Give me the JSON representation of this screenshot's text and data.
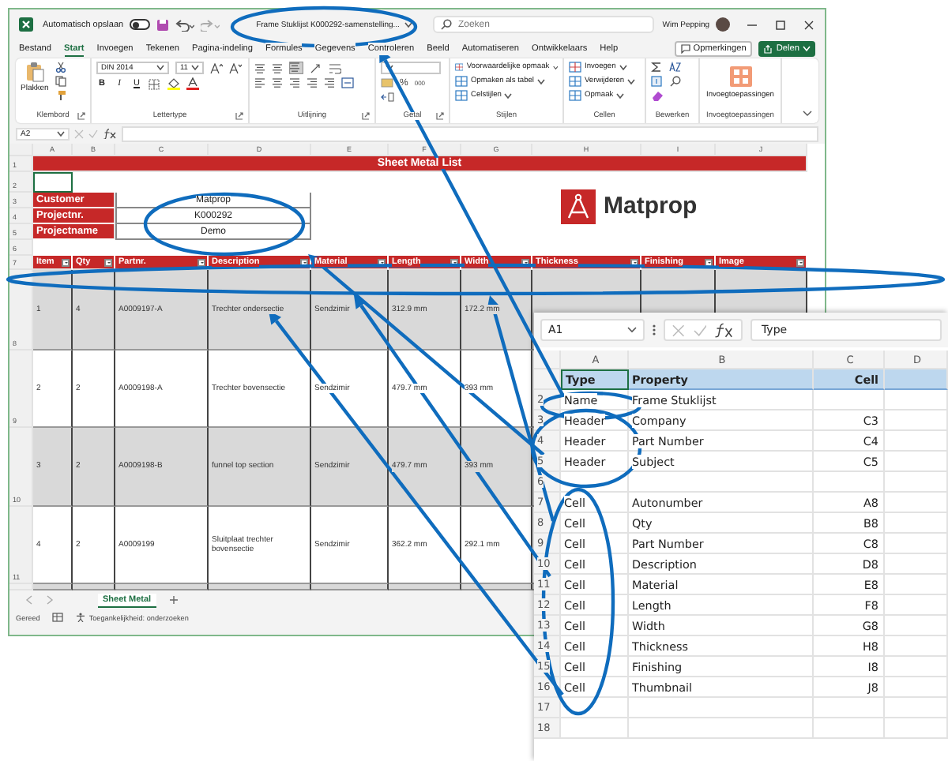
{
  "title_bar": {
    "autosave_label": "Automatisch opslaan",
    "autosave_on": false,
    "document_title": "Frame Stuklijst K000292-samenstelling...",
    "search": {
      "placeholder": "Zoeken"
    },
    "user": "Wim Pepping"
  },
  "tabs": [
    {
      "label": "Bestand",
      "selected": false
    },
    {
      "label": "Start",
      "selected": true
    },
    {
      "label": "Invoegen",
      "selected": false
    },
    {
      "label": "Tekenen",
      "selected": false
    },
    {
      "label": "Pagina-indeling",
      "selected": false
    },
    {
      "label": "Formules",
      "selected": false
    },
    {
      "label": "Gegevens",
      "selected": false
    },
    {
      "label": "Controleren",
      "selected": false
    },
    {
      "label": "Beeld",
      "selected": false
    },
    {
      "label": "Automatiseren",
      "selected": false
    },
    {
      "label": "Ontwikkelaars",
      "selected": false
    },
    {
      "label": "Help",
      "selected": false
    }
  ],
  "actions": {
    "comments": "Opmerkingen",
    "share": "Delen"
  },
  "ribbon": [
    {
      "kind": "clipboard",
      "label": "Klembord",
      "paste": "Plakken"
    },
    {
      "kind": "font",
      "label": "Lettertype",
      "font": "DIN 2014",
      "size": "11",
      "styles": [
        "B",
        "I",
        "U"
      ]
    },
    {
      "kind": "alignment",
      "label": "Uitlijning"
    },
    {
      "kind": "number",
      "label": "Getal",
      "percent": "%",
      "thousands": "000"
    },
    {
      "kind": "styles",
      "label": "Stijlen",
      "items": [
        "Voorwaardelijke opmaak",
        "Opmaken als tabel",
        "Celstijlen"
      ]
    },
    {
      "kind": "cells",
      "label": "Cellen",
      "items": [
        "Invoegen",
        "Verwijderen",
        "Opmaak"
      ]
    },
    {
      "kind": "editing",
      "label": "Bewerken"
    },
    {
      "kind": "addins",
      "label": "Invoegtoepassingen",
      "button": "Invoegtoepassingen"
    }
  ],
  "formula_bar": {
    "cell": "A2"
  },
  "sheet": {
    "columns": [
      "A",
      "B",
      "C",
      "D",
      "E",
      "F",
      "G",
      "H",
      "I",
      "J"
    ],
    "row_numbers": [
      "1",
      "2",
      "3",
      "4",
      "5",
      "6",
      "7",
      "8",
      "9",
      "10",
      "11"
    ],
    "title": "Sheet Metal List",
    "info": [
      {
        "label": "Customer",
        "value": "Matprop"
      },
      {
        "label": "Projectnr.",
        "value": "K000292"
      },
      {
        "label": "Projectname",
        "value": "Demo"
      }
    ],
    "logo": "Matprop",
    "table": {
      "columns": [
        "Item",
        "Qty",
        "Partnr.",
        "Description",
        "Material",
        "Length",
        "Width",
        "Thickness",
        "Finishing",
        "Image"
      ],
      "rows": [
        [
          "1",
          "4",
          "A0009197-A",
          "Trechter ondersectie",
          "Sendzimir",
          "312.9 mm",
          "172.2 mm"
        ],
        [
          "2",
          "2",
          "A0009198-A",
          "Trechter bovensectie",
          "Sendzimir",
          "479.7 mm",
          "393 mm"
        ],
        [
          "3",
          "2",
          "A0009198-B",
          "funnel top section",
          "Sendzimir",
          "479.7 mm",
          "393 mm"
        ],
        [
          "4",
          "2",
          "A0009199",
          "Sluitplaat trechter bovensectie",
          "Sendzimir",
          "362.2 mm",
          "292.1 mm"
        ]
      ]
    }
  },
  "sheet_tabs": [
    {
      "label": "Sheet Metal",
      "selected": true
    }
  ],
  "status_bar": {
    "state": "Gereed",
    "accessibility": "Toegankelijkheid: onderzoeken"
  },
  "mapping_sheet": {
    "name_box": "A1",
    "formula": "Type",
    "columns": [
      "A",
      "B",
      "C",
      "D"
    ],
    "rows": [
      {
        "kind": "header",
        "cells": [
          "Type",
          "Property",
          "Cell"
        ]
      },
      {
        "kind": "data",
        "number": "2",
        "cells": [
          "Name",
          "Frame Stuklijst"
        ]
      },
      {
        "kind": "data",
        "number": "3",
        "cells": [
          "Header",
          "Company",
          "C3"
        ]
      },
      {
        "kind": "data",
        "number": "4",
        "cells": [
          "Header",
          "Part Number",
          "C4"
        ]
      },
      {
        "kind": "data",
        "number": "5",
        "cells": [
          "Header",
          "Subject",
          "C5"
        ]
      },
      {
        "kind": "data",
        "number": "6",
        "cells": []
      },
      {
        "kind": "data",
        "number": "7",
        "cells": [
          "Cell",
          "Autonumber",
          "A8"
        ]
      },
      {
        "kind": "data",
        "number": "8",
        "cells": [
          "Cell",
          "Qty",
          "B8"
        ]
      },
      {
        "kind": "data",
        "number": "9",
        "cells": [
          "Cell",
          "Part Number",
          "C8"
        ]
      },
      {
        "kind": "data",
        "number": "10",
        "cells": [
          "Cell",
          "Description",
          "D8"
        ]
      },
      {
        "kind": "data",
        "number": "11",
        "cells": [
          "Cell",
          "Material",
          "E8"
        ]
      },
      {
        "kind": "data",
        "number": "12",
        "cells": [
          "Cell",
          "Length",
          "F8"
        ]
      },
      {
        "kind": "data",
        "number": "13",
        "cells": [
          "Cell",
          "Width",
          "G8"
        ]
      },
      {
        "kind": "data",
        "number": "14",
        "cells": [
          "Cell",
          "Thickness",
          "H8"
        ]
      },
      {
        "kind": "data",
        "number": "15",
        "cells": [
          "Cell",
          "Finishing",
          "I8"
        ]
      },
      {
        "kind": "data",
        "number": "16",
        "cells": [
          "Cell",
          "Thumbnail",
          "J8"
        ]
      },
      {
        "kind": "data",
        "number": "17",
        "cells": []
      },
      {
        "kind": "data",
        "number": "18",
        "cells": []
      }
    ]
  }
}
